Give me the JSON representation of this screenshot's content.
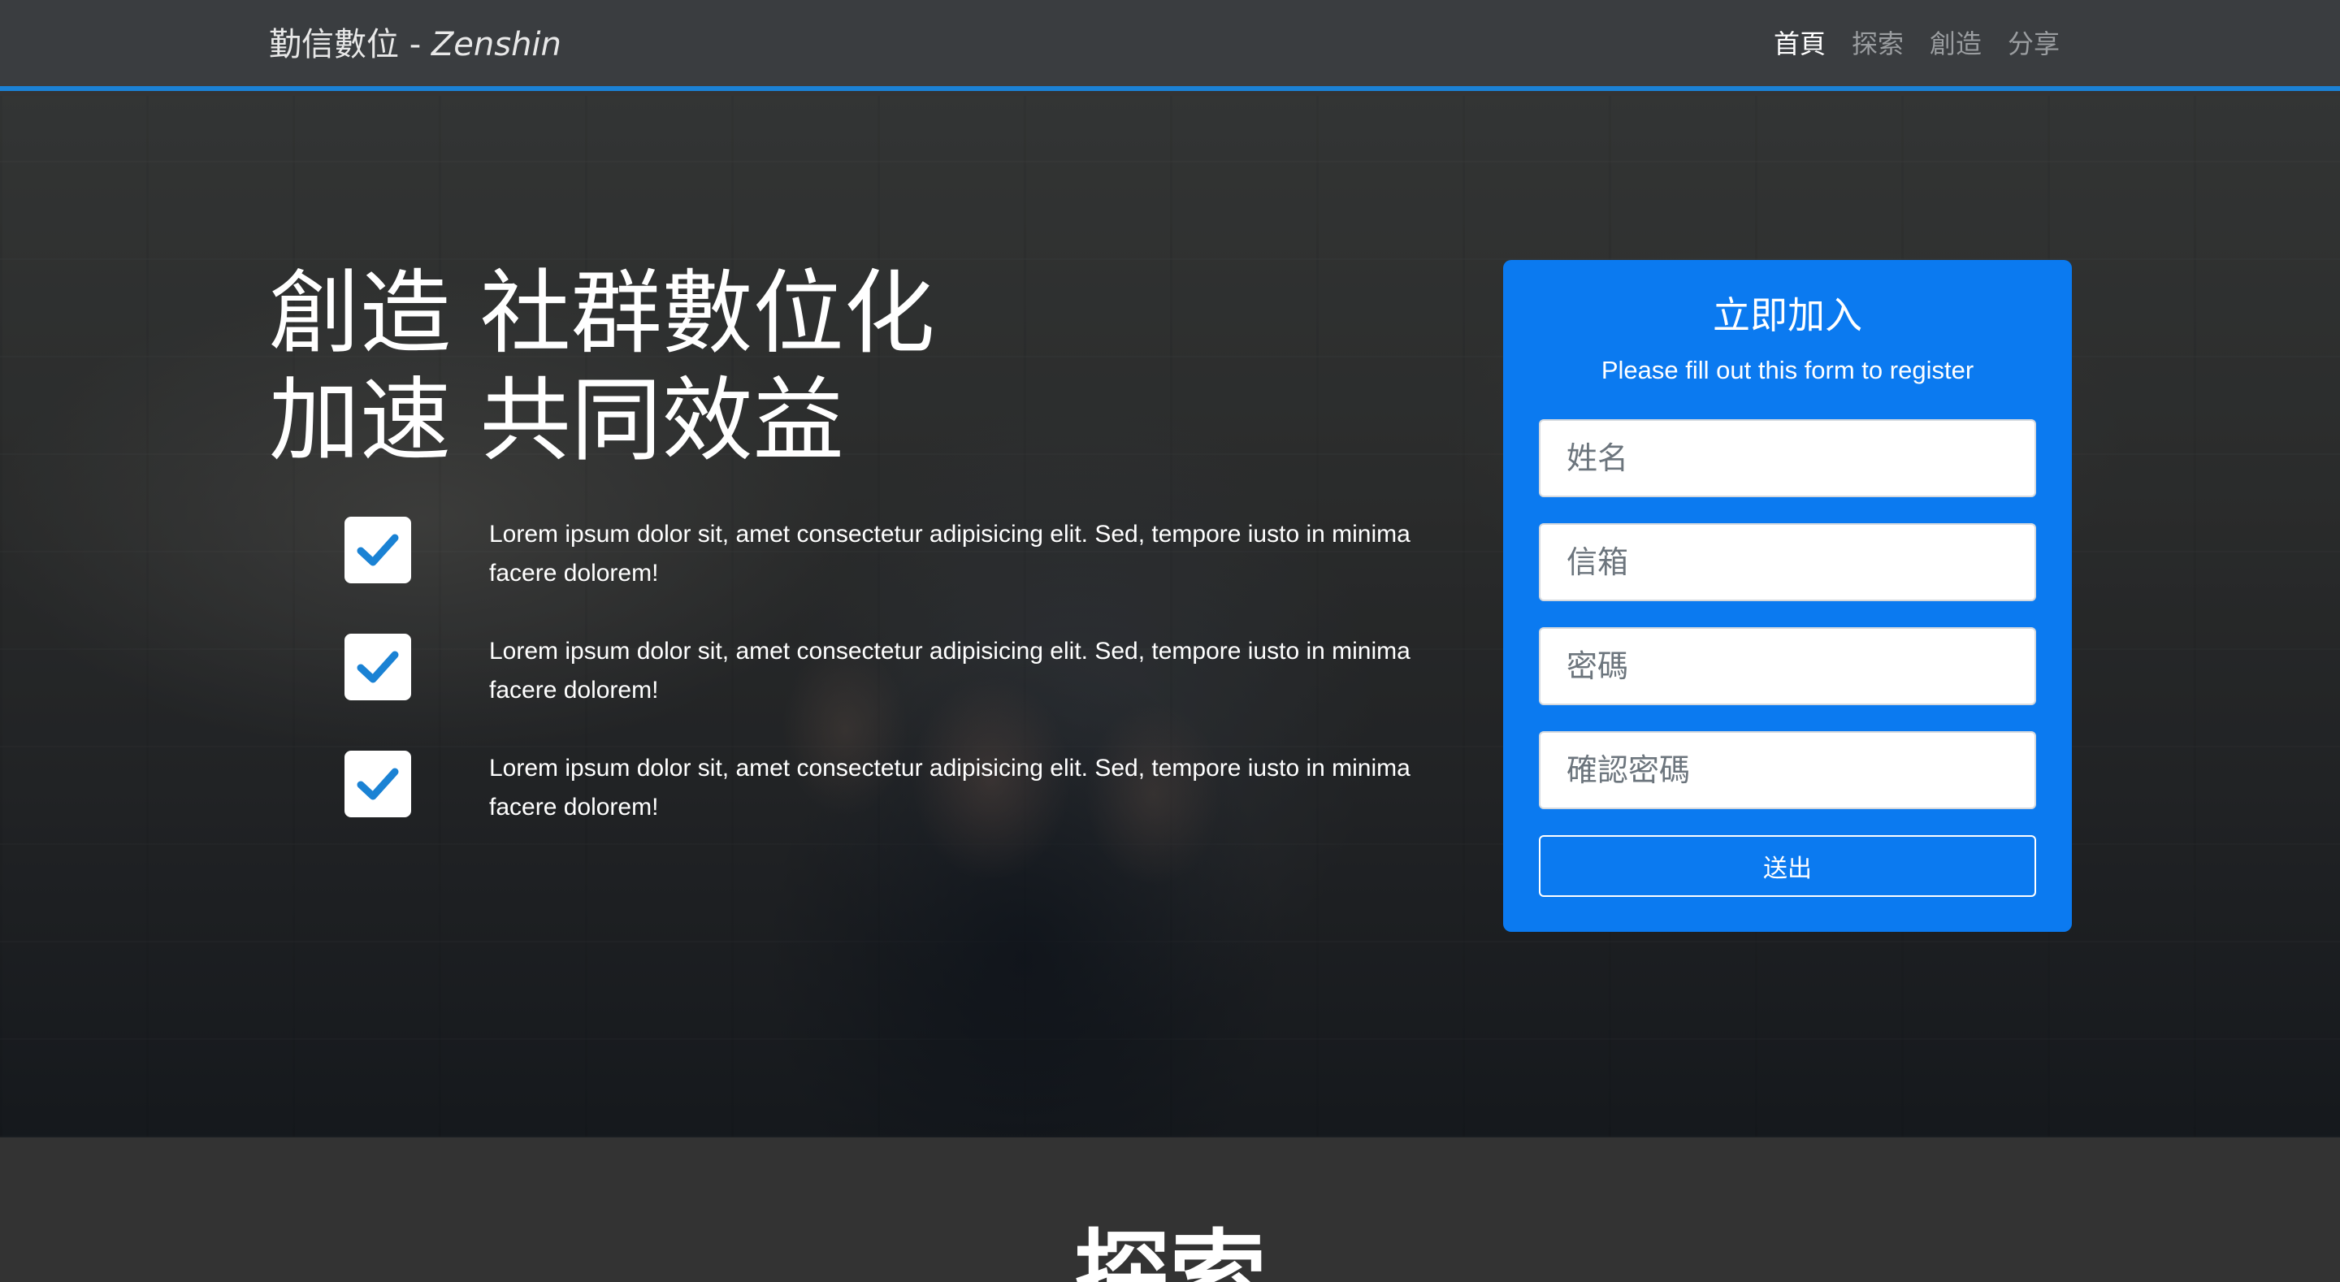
{
  "navbar": {
    "brand_main": "勤信數位 - ",
    "brand_sub": "Zenshin",
    "links": [
      {
        "label": "首頁",
        "active": true
      },
      {
        "label": "探索",
        "active": false
      },
      {
        "label": "創造",
        "active": false
      },
      {
        "label": "分享",
        "active": false
      }
    ]
  },
  "hero": {
    "title_line1": "創造 社群數位化",
    "title_line2": "加速 共同效益",
    "features": [
      {
        "icon": "check-icon",
        "text": "Lorem ipsum dolor sit, amet consectetur adipisicing elit. Sed, tempore iusto in minima facere dolorem!"
      },
      {
        "icon": "check-icon",
        "text": "Lorem ipsum dolor sit, amet consectetur adipisicing elit. Sed, tempore iusto in minima facere dolorem!"
      },
      {
        "icon": "check-icon",
        "text": "Lorem ipsum dolor sit, amet consectetur adipisicing elit. Sed, tempore iusto in minima facere dolorem!"
      }
    ]
  },
  "register": {
    "title": "立即加入",
    "subtitle": "Please fill out this form to register",
    "name_placeholder": "姓名",
    "email_placeholder": "信箱",
    "password_placeholder": "密碼",
    "confirm_placeholder": "確認密碼",
    "submit_label": "送出"
  },
  "explore": {
    "title": "探索"
  },
  "colors": {
    "accent": "#0b7af0",
    "nav_border": "#1b82d6",
    "check": "#1a82d4"
  }
}
